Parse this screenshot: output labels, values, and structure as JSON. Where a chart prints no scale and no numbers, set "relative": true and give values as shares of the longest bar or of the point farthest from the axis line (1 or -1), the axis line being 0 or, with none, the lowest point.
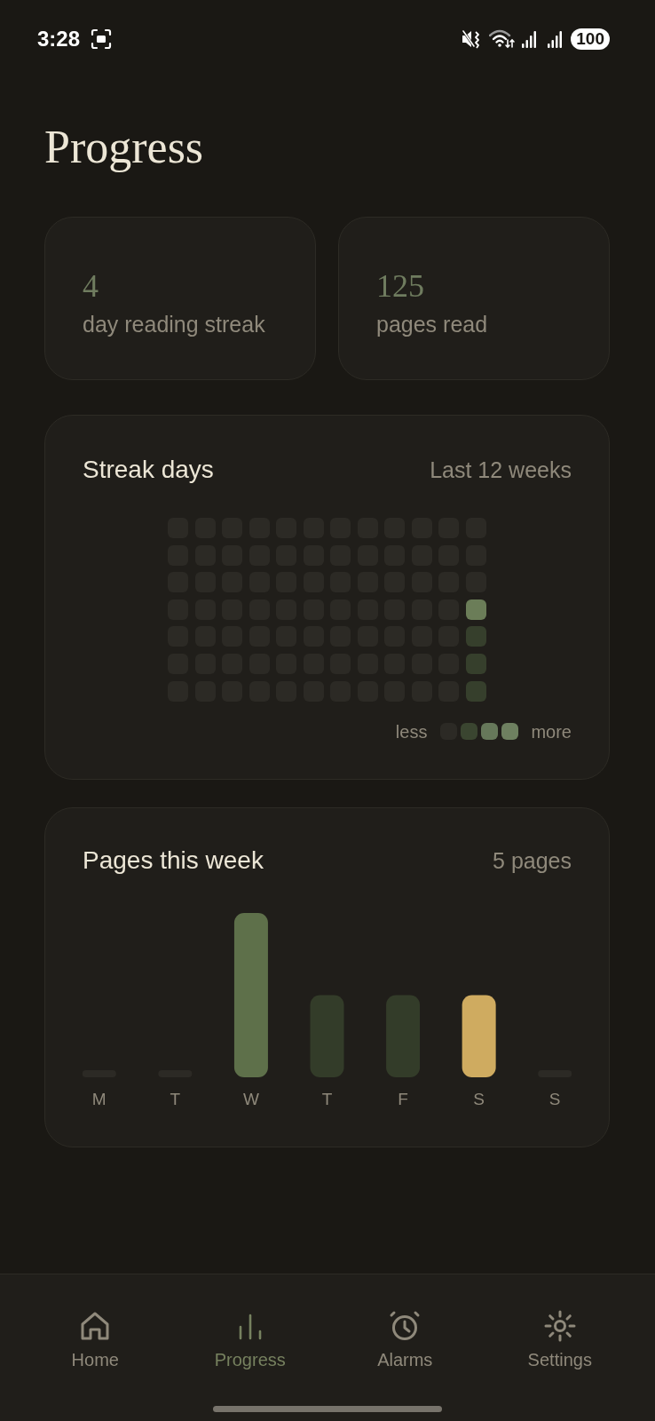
{
  "status_bar": {
    "time": "3:28",
    "battery": "100"
  },
  "title": "Progress",
  "stats": [
    {
      "value": "4",
      "label": "day reading streak"
    },
    {
      "value": "125",
      "label": "pages read"
    }
  ],
  "streak_card": {
    "title": "Streak days",
    "range": "Last 12 weeks",
    "weeks": [
      {
        "days": [
          {
            "color": "#2c2a25"
          },
          {
            "color": "#2c2a25"
          },
          {
            "color": "#2c2a25"
          },
          {
            "color": "#2c2a25"
          },
          {
            "color": "#2c2a25"
          },
          {
            "color": "#2c2a25"
          },
          {
            "color": "#2c2a25"
          }
        ]
      },
      {
        "days": [
          {
            "color": "#2c2a25"
          },
          {
            "color": "#2c2a25"
          },
          {
            "color": "#2c2a25"
          },
          {
            "color": "#2c2a25"
          },
          {
            "color": "#2c2a25"
          },
          {
            "color": "#2c2a25"
          },
          {
            "color": "#2c2a25"
          }
        ]
      },
      {
        "days": [
          {
            "color": "#2c2a25"
          },
          {
            "color": "#2c2a25"
          },
          {
            "color": "#2c2a25"
          },
          {
            "color": "#2c2a25"
          },
          {
            "color": "#2c2a25"
          },
          {
            "color": "#2c2a25"
          },
          {
            "color": "#2c2a25"
          }
        ]
      },
      {
        "days": [
          {
            "color": "#2c2a25"
          },
          {
            "color": "#2c2a25"
          },
          {
            "color": "#2c2a25"
          },
          {
            "color": "#2c2a25"
          },
          {
            "color": "#2c2a25"
          },
          {
            "color": "#2c2a25"
          },
          {
            "color": "#2c2a25"
          }
        ]
      },
      {
        "days": [
          {
            "color": "#2c2a25"
          },
          {
            "color": "#2c2a25"
          },
          {
            "color": "#2c2a25"
          },
          {
            "color": "#2c2a25"
          },
          {
            "color": "#2c2a25"
          },
          {
            "color": "#2c2a25"
          },
          {
            "color": "#2c2a25"
          }
        ]
      },
      {
        "days": [
          {
            "color": "#2c2a25"
          },
          {
            "color": "#2c2a25"
          },
          {
            "color": "#2c2a25"
          },
          {
            "color": "#2c2a25"
          },
          {
            "color": "#2c2a25"
          },
          {
            "color": "#2c2a25"
          },
          {
            "color": "#2c2a25"
          }
        ]
      },
      {
        "days": [
          {
            "color": "#2c2a25"
          },
          {
            "color": "#2c2a25"
          },
          {
            "color": "#2c2a25"
          },
          {
            "color": "#2c2a25"
          },
          {
            "color": "#2c2a25"
          },
          {
            "color": "#2c2a25"
          },
          {
            "color": "#2c2a25"
          }
        ]
      },
      {
        "days": [
          {
            "color": "#2c2a25"
          },
          {
            "color": "#2c2a25"
          },
          {
            "color": "#2c2a25"
          },
          {
            "color": "#2c2a25"
          },
          {
            "color": "#2c2a25"
          },
          {
            "color": "#2c2a25"
          },
          {
            "color": "#2c2a25"
          }
        ]
      },
      {
        "days": [
          {
            "color": "#2c2a25"
          },
          {
            "color": "#2c2a25"
          },
          {
            "color": "#2c2a25"
          },
          {
            "color": "#2c2a25"
          },
          {
            "color": "#2c2a25"
          },
          {
            "color": "#2c2a25"
          },
          {
            "color": "#2c2a25"
          }
        ]
      },
      {
        "days": [
          {
            "color": "#2c2a25"
          },
          {
            "color": "#2c2a25"
          },
          {
            "color": "#2c2a25"
          },
          {
            "color": "#2c2a25"
          },
          {
            "color": "#2c2a25"
          },
          {
            "color": "#2c2a25"
          },
          {
            "color": "#2c2a25"
          }
        ]
      },
      {
        "days": [
          {
            "color": "#2c2a25"
          },
          {
            "color": "#2c2a25"
          },
          {
            "color": "#2c2a25"
          },
          {
            "color": "#2c2a25"
          },
          {
            "color": "#2c2a25"
          },
          {
            "color": "#2c2a25"
          },
          {
            "color": "#2c2a25"
          }
        ]
      },
      {
        "days": [
          {
            "color": "#2c2a25"
          },
          {
            "color": "#2c2a25"
          },
          {
            "color": "#2c2a25"
          },
          {
            "color": "#6b7d58"
          },
          {
            "color": "#363f2c"
          },
          {
            "color": "#363f2c"
          },
          {
            "color": "#363f2c"
          }
        ]
      }
    ],
    "legend": {
      "low_label": "less",
      "swatches": [
        {
          "color": "#2c2a25"
        },
        {
          "color": "#3a4530"
        },
        {
          "color": "#66785a"
        },
        {
          "color": "#6e8060"
        }
      ],
      "high_label": "more"
    }
  },
  "pages_card": {
    "title": "Pages this week",
    "total": "5 pages",
    "chart_data": {
      "type": "bar",
      "relative": true,
      "categories": [
        "M",
        "T",
        "W",
        "T",
        "F",
        "S",
        "S"
      ],
      "values": [
        0,
        0,
        1,
        0.5,
        0.5,
        0.5,
        0
      ]
    },
    "bars": [
      {
        "color": "#2c2a25"
      },
      {
        "color": "#2c2a25"
      },
      {
        "color": "#5e704a"
      },
      {
        "color": "#333c29"
      },
      {
        "color": "#333c29"
      },
      {
        "color": "#cfab60"
      },
      {
        "color": "#2c2a25"
      }
    ]
  },
  "nav": [
    {
      "label": "Home",
      "selected": false
    },
    {
      "label": "Progress",
      "selected": true
    },
    {
      "label": "Alarms",
      "selected": false
    },
    {
      "label": "Settings",
      "selected": false
    }
  ]
}
